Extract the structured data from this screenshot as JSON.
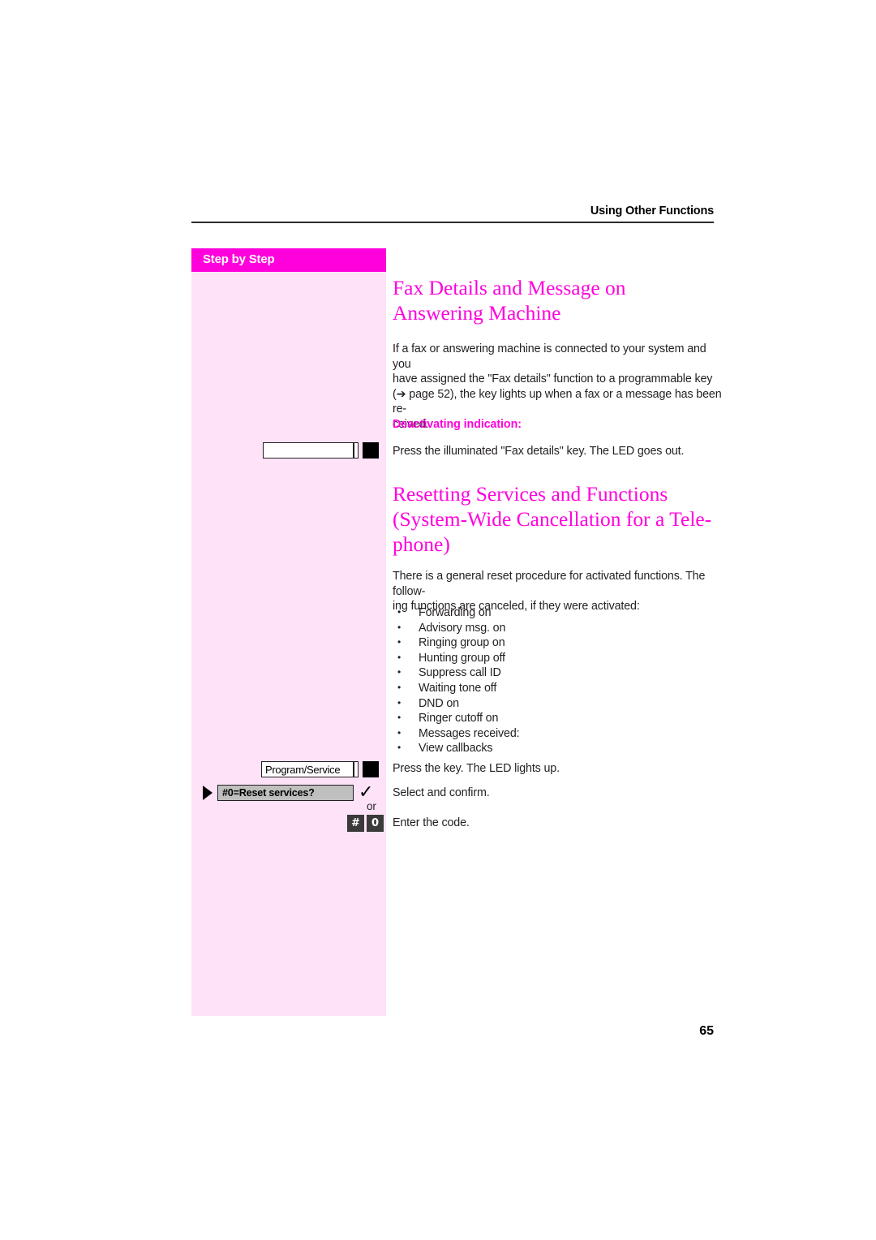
{
  "header": {
    "running_title": "Using Other Functions"
  },
  "sidebar": {
    "title": "Step by Step"
  },
  "folio": {
    "page_number": "65"
  },
  "colors": {
    "magenta": "#ff00dd",
    "sidebar_tint": "#fde2f8",
    "body_text": "#231f20",
    "display_gray": "#bfbfbf",
    "keycap_dark": "#3a3a3a"
  },
  "section_one": {
    "heading": "Fax Details and Message on Answering Machine",
    "intro_line1": "If a fax or answering machine is connected to your system and you",
    "intro_line2": "have assigned the \"Fax details\" function to a programmable key",
    "intro_line3_pre": "(",
    "intro_arrow": "➔",
    "intro_line3_post": " page 52), the key lights up when a fax or a message has been re-",
    "intro_line4": "ceived.",
    "subhead": "Deactivating indication:",
    "step_caption": "Press the illuminated \"Fax details\" key. The LED goes out.",
    "key_widget": {
      "label": "",
      "led_state": "on"
    }
  },
  "section_two": {
    "heading": "Resetting Services and Functions (System-Wide Cancellation for a Telephone)",
    "heading_line1": "Resetting Services and Functions",
    "heading_line2": "(System-Wide Cancellation for a Tele-",
    "heading_line3": "phone)",
    "intro_line1": "There is a general reset procedure for activated functions. The follow-",
    "intro_line2": "ing functions are canceled, if they were activated:",
    "bullets": [
      "Forwarding on",
      "Advisory msg. on",
      "Ringing group on",
      "Hunting group off",
      "Suppress call ID",
      "Waiting tone off",
      "DND on",
      "Ringer cutoff on",
      "Messages received:",
      "View callbacks"
    ],
    "steps": [
      {
        "key_label": "Program/Service",
        "caption": "Press the key. The LED lights up."
      },
      {
        "display_text": "#0=Reset services?",
        "caption": "Select and confirm."
      },
      {
        "or_label": "or",
        "keys": [
          "#",
          "0"
        ],
        "caption": "Enter the code."
      }
    ]
  }
}
